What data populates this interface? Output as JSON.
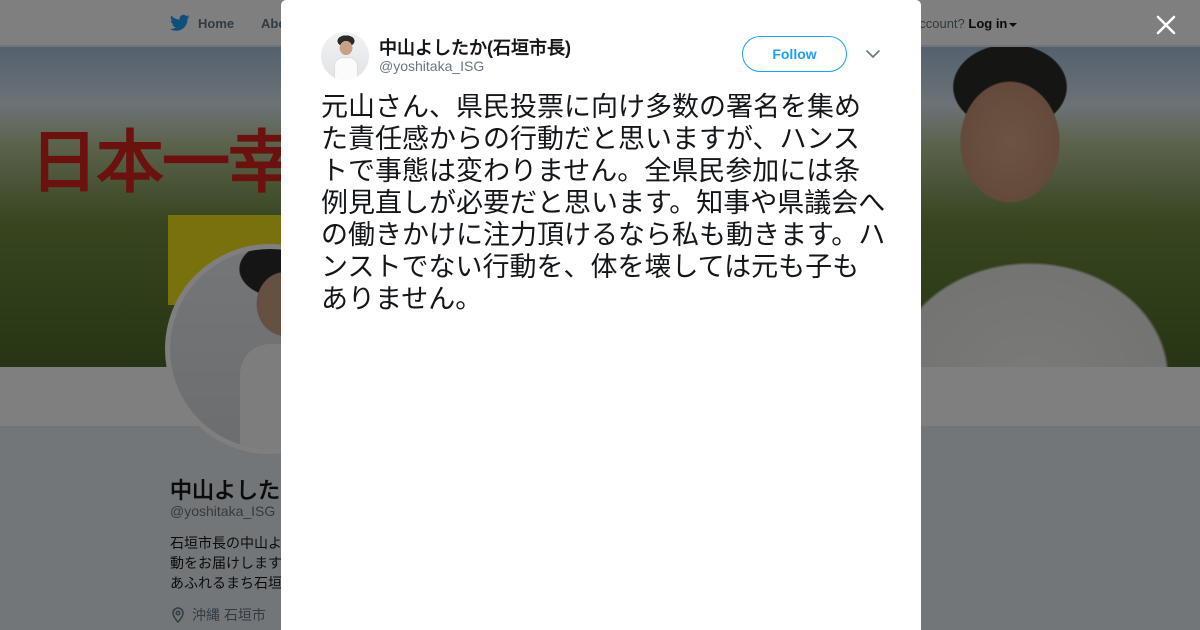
{
  "nav": {
    "home_label": "Home",
    "about_label": "Abo",
    "account_prompt": "account?",
    "login_label": "Log in"
  },
  "banner": {
    "slogan": "日本一幸"
  },
  "profile": {
    "name": "中山よした",
    "handle": "@yoshitaka_ISG",
    "bio_lines": [
      "石垣市長の中山よ",
      "動をお届けします",
      "あふれるまち石垣"
    ],
    "location": "沖縄 石垣市"
  },
  "tweet": {
    "author_name": "中山よしたか(石垣市長)",
    "author_handle": "@yoshitaka_ISG",
    "follow_label": "Follow",
    "text": "元山さん、県民投票に向け多数の署名を集めた責任感からの行動だと思いますが、ハンストで事態は変わりません。全県民参加には条例見直しが必要だと思います。知事や県議会への働きかけに注力頂けるなら私も動きます。ハンストでない行動を、体を壊しては元も子もありません。"
  },
  "colors": {
    "twitter_blue": "#1da1f2",
    "overlay": "rgba(0,0,0,0.5)"
  },
  "icons": {
    "close": "close-icon",
    "bird": "twitter-bird-icon",
    "chevron": "chevron-down-icon",
    "location": "location-pin-icon"
  }
}
